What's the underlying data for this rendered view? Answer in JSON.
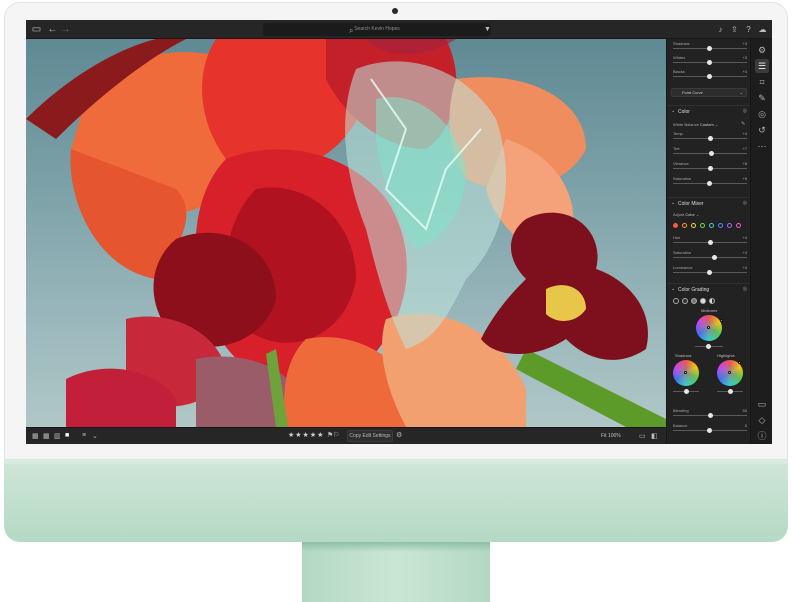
{
  "topbar": {
    "search_placeholder": "Search Kevin Hopes",
    "icons": [
      "sidebar-toggle-icon",
      "back-arrow-icon",
      "forward-arrow-icon",
      "filter-icon",
      "bell-icon",
      "share-icon",
      "help-icon",
      "cloud-icon"
    ]
  },
  "panel": {
    "light_sliders": [
      {
        "label": "Shadows",
        "value": "+3",
        "pos": 0.48
      },
      {
        "label": "Whites",
        "value": "+3",
        "pos": 0.48
      },
      {
        "label": "Blacks",
        "value": "+4",
        "pos": 0.48
      }
    ],
    "point_curve": "Point Curve",
    "color_section": {
      "title": "Color",
      "white_balance_label": "White Balance",
      "white_balance_value": "Custom",
      "sliders": [
        {
          "label": "Temp",
          "value": "+4",
          "pos": 0.5
        },
        {
          "label": "Tint",
          "value": "+7",
          "pos": 0.52
        },
        {
          "label": "Vibrance",
          "value": "+8",
          "pos": 0.5
        },
        {
          "label": "Saturation",
          "value": "+5",
          "pos": 0.48
        }
      ]
    },
    "color_mixer": {
      "title": "Color Mixer",
      "adjust_label": "Adjust",
      "adjust_value": "Color",
      "dot_colors": [
        "#ff5a3c",
        "#ff9a2e",
        "#ffd230",
        "#6fd84c",
        "#3fd5c8",
        "#4f8bff",
        "#a266ff",
        "#ff56c8"
      ],
      "sliders": [
        {
          "label": "Hue",
          "value": "+4",
          "pos": 0.5
        },
        {
          "label": "Saturation",
          "value": "+4",
          "pos": 0.55
        },
        {
          "label": "Luminance",
          "value": "+4",
          "pos": 0.48
        }
      ]
    },
    "color_grading": {
      "title": "Color Grading",
      "midtones_label": "Midtones",
      "shadows_label": "Shadows",
      "highlights_label": "Highlights",
      "sliders": [
        {
          "label": "Blending",
          "value": "50",
          "pos": 0.5
        },
        {
          "label": "Balance",
          "value": "0",
          "pos": 0.48
        }
      ]
    }
  },
  "filmstrip": {
    "stars": "★★★★★",
    "copy_button": "Copy Edit Settings",
    "fit_label": "Fit   100%"
  },
  "rail_icons": [
    "edit-sliders-icon",
    "crop-icon",
    "healing-icon",
    "masking-icon",
    "history-icon",
    "more-icon",
    "comment-icon",
    "tag-icon",
    "info-icon"
  ]
}
